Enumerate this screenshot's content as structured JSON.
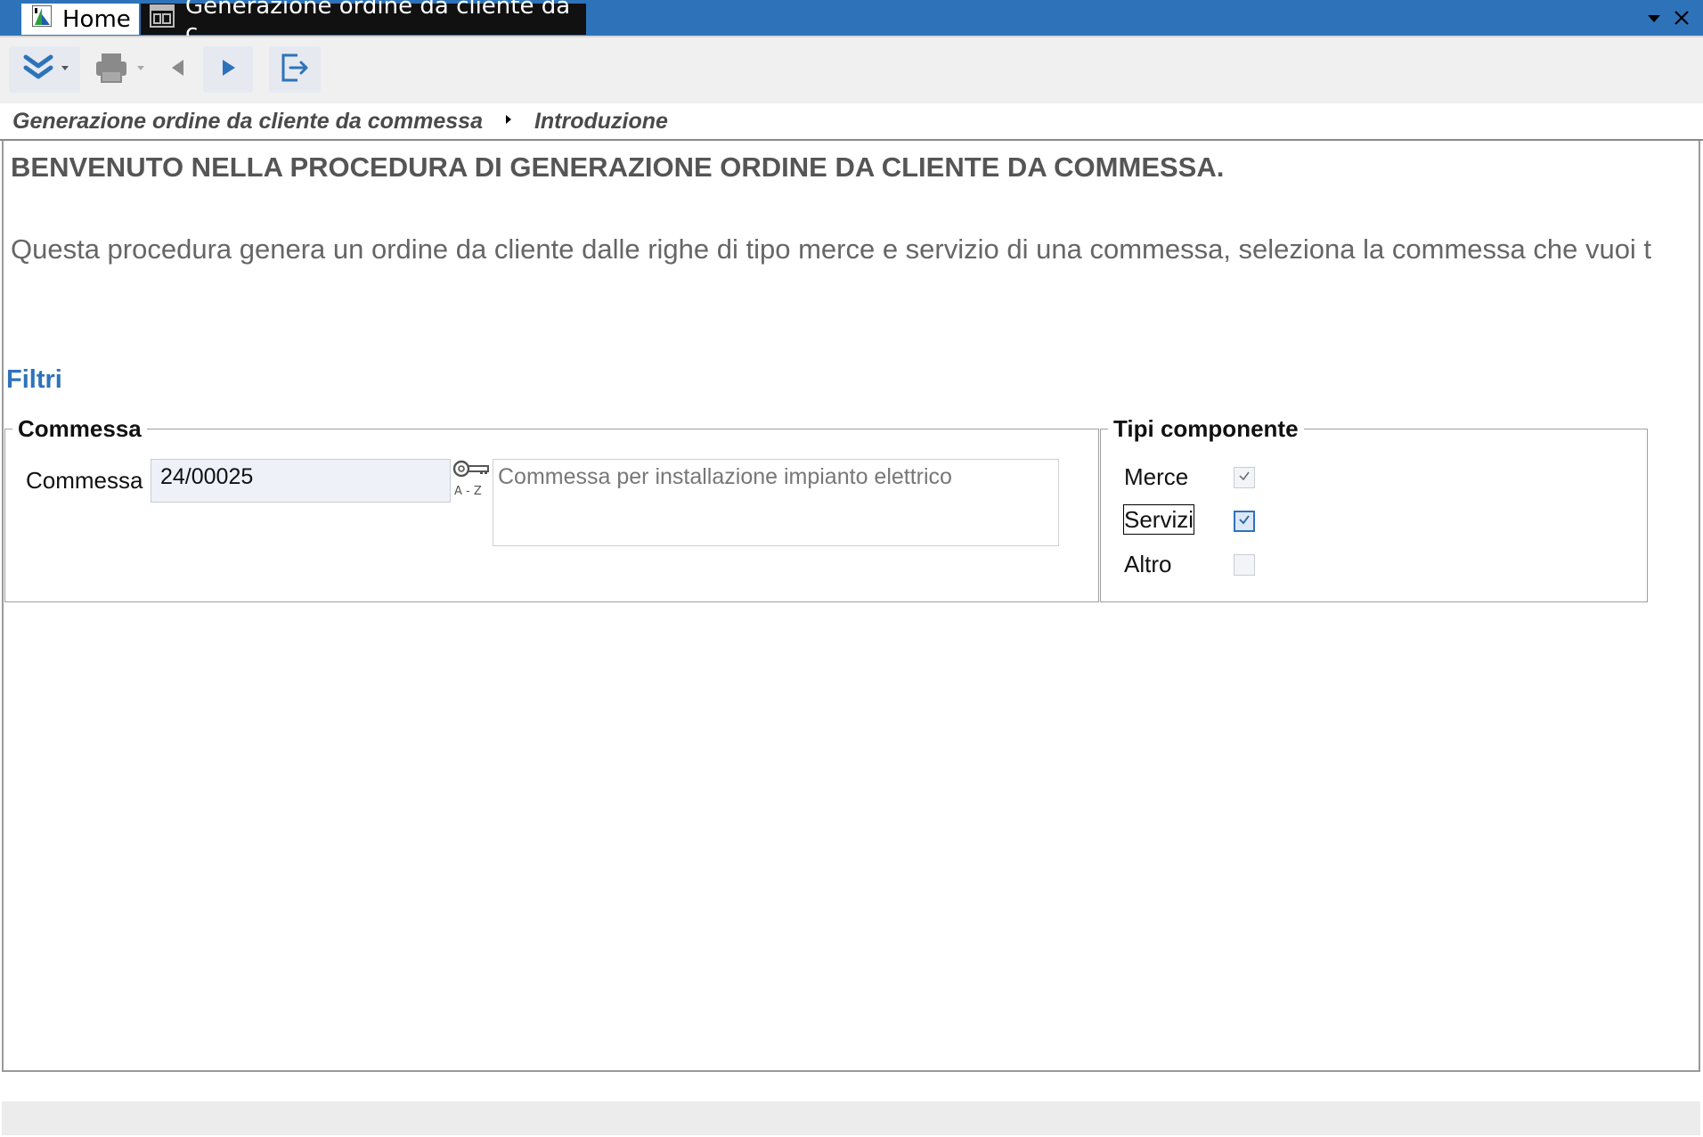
{
  "tabs": [
    {
      "label": "Home"
    },
    {
      "label": "Generazione ordine da cliente da c..."
    }
  ],
  "breadcrumb": {
    "items": [
      "Generazione ordine da cliente da commessa",
      "Introduzione"
    ]
  },
  "page": {
    "heading": "BENVENUTO NELLA PROCEDURA DI GENERAZIONE ORDINE DA CLIENTE DA COMMESSA.",
    "intro": "Questa procedura genera un ordine da cliente dalle righe di tipo merce e servizio di una commessa, seleziona la commessa che vuoi t",
    "filters_title": "Filtri"
  },
  "commessa_group": {
    "legend": "Commessa",
    "field_label": "Commessa",
    "value": "24/00025",
    "lookup_caption": "A - Z",
    "description": "Commessa per installazione impianto elettrico"
  },
  "tipi_group": {
    "legend": "Tipi componente",
    "options": [
      {
        "label": "Merce",
        "checked": true
      },
      {
        "label": "Servizi",
        "checked": true
      },
      {
        "label": "Altro",
        "checked": false
      }
    ]
  },
  "colors": {
    "accent": "#2e73ba",
    "tab_active_bg": "#111111",
    "heading": "#555555"
  },
  "icons": [
    "app-logo-icon",
    "form-icon",
    "expand-more-icon",
    "print-icon",
    "prev-icon",
    "next-icon",
    "exit-icon",
    "key-lookup-icon",
    "dropdown-arrow-icon",
    "close-icon"
  ]
}
